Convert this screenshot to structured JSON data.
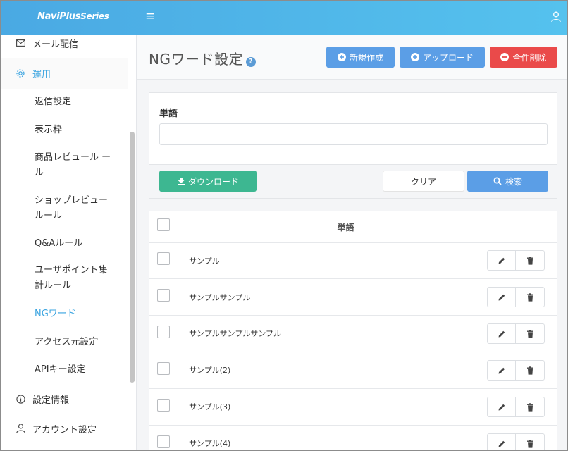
{
  "app": {
    "logo_main": "NaviPlus",
    "logo_sub": "Series"
  },
  "sidebar": {
    "items": [
      {
        "label": "メール配信",
        "icon": "mail-icon"
      },
      {
        "label": "運用",
        "icon": "gear-icon",
        "active": true
      },
      {
        "label": "設定情報",
        "icon": "info-icon"
      },
      {
        "label": "アカウント設定",
        "icon": "user-icon"
      }
    ],
    "sub_items": [
      {
        "label": "返信設定"
      },
      {
        "label": "表示枠"
      },
      {
        "label": "商品レビュール ール"
      },
      {
        "label": "ショップレビュー ルール"
      },
      {
        "label": "Q&Aルール"
      },
      {
        "label": "ユーザポイント集 計ルール"
      },
      {
        "label": "NGワード",
        "active": true
      },
      {
        "label": "アクセス元設定"
      },
      {
        "label": "APIキー設定"
      }
    ]
  },
  "header": {
    "title": "NGワード設定",
    "help": "?",
    "buttons": {
      "new": "新規作成",
      "upload": "アップロード",
      "delete_all": "全件削除"
    }
  },
  "search": {
    "label": "単語",
    "value": "",
    "placeholder": "",
    "download": "ダウンロード",
    "clear": "クリア",
    "search": "検索"
  },
  "table": {
    "header": "単語",
    "rows": [
      {
        "word": "サンプル"
      },
      {
        "word": "サンプルサンプル"
      },
      {
        "word": "サンプルサンプルサンプル"
      },
      {
        "word": "サンプル(2)"
      },
      {
        "word": "サンプル(3)"
      },
      {
        "word": "サンプル(4)"
      }
    ]
  },
  "colors": {
    "topbar": "#4aa9e3",
    "accent": "#3aa4e0",
    "primary_button": "#5b9ee6",
    "danger_button": "#ea4a4a",
    "download_button": "#3db791"
  }
}
